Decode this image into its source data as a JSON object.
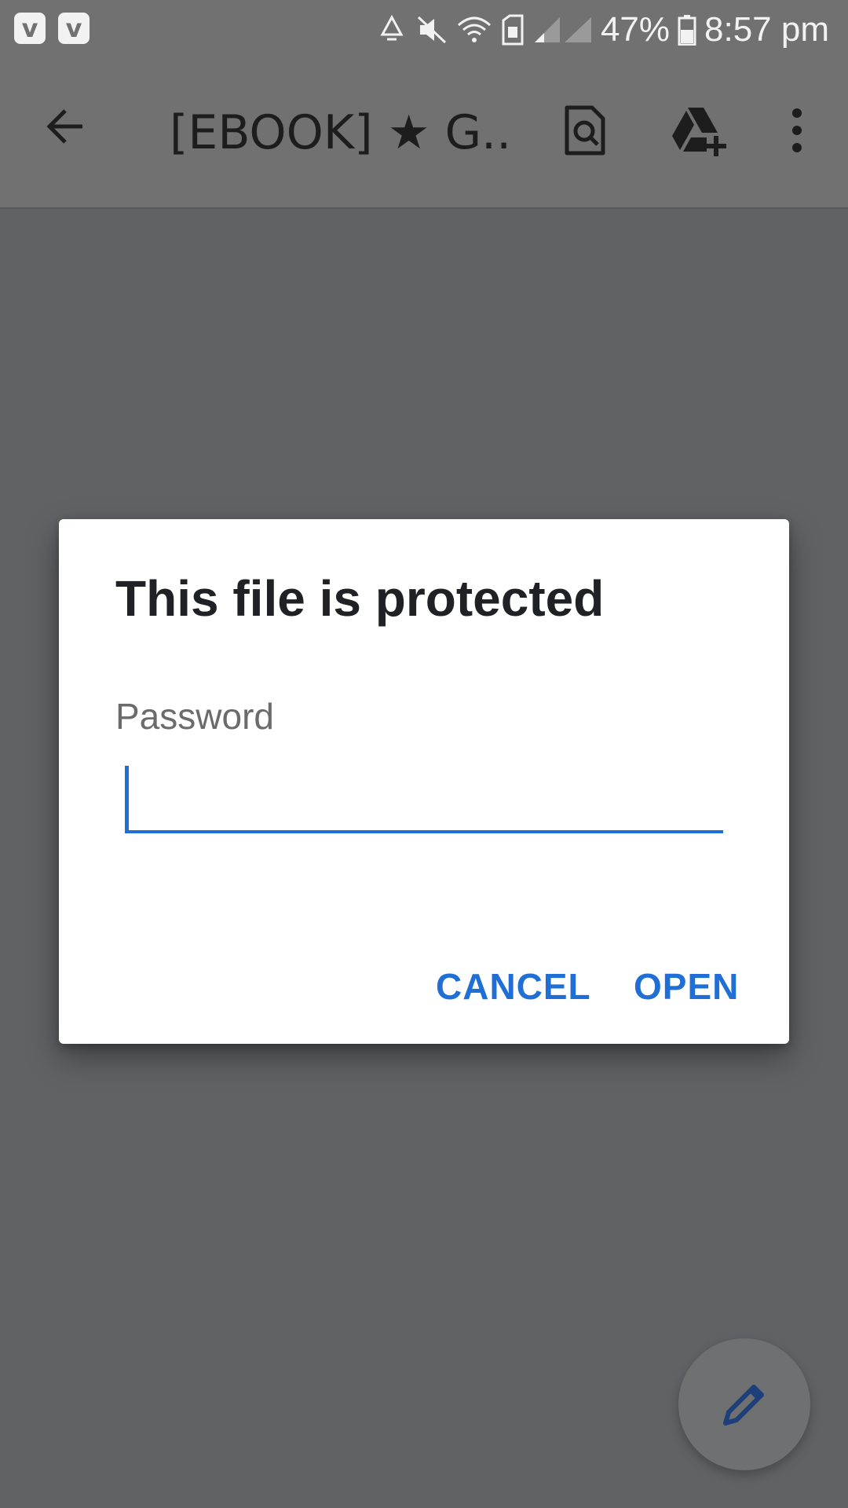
{
  "status_bar": {
    "notification_icons": [
      "v-app-icon",
      "v-app-icon"
    ],
    "battery_percent": "47%",
    "time": "8:57 pm",
    "icons": [
      "recycle-icon",
      "mute-icon",
      "wifi-icon",
      "sim-icon",
      "signal-icon",
      "battery-icon"
    ]
  },
  "toolbar": {
    "title": "[EBOOK] ★ G...",
    "icons": [
      "back-arrow-icon",
      "find-in-page-icon",
      "add-to-drive-icon",
      "more-vert-icon"
    ]
  },
  "dialog": {
    "title": "This file is protected",
    "password_label": "Password",
    "password_value": "",
    "cancel_label": "CANCEL",
    "open_label": "OPEN"
  },
  "fab": {
    "icon": "edit-pencil-icon"
  },
  "colors": {
    "accent": "#1f6fd6",
    "scrim": "#616265",
    "dialog_bg": "#ffffff"
  }
}
